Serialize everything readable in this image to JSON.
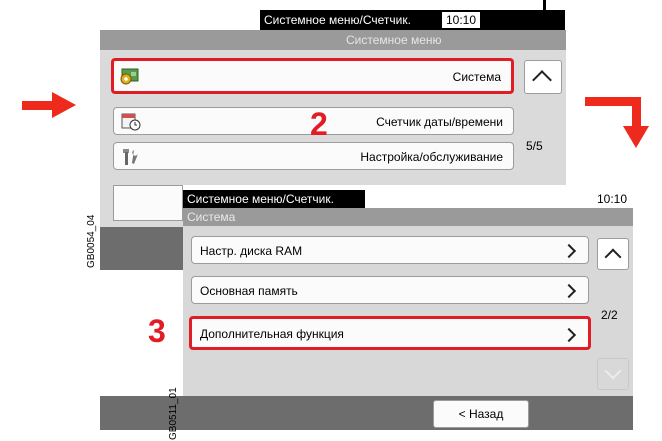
{
  "screen1": {
    "title": "Системное меню/Счетчик.",
    "time": "10:10",
    "subtitle": "Системное меню",
    "rows": [
      {
        "label": "Система",
        "icon": "system-gear-icon"
      },
      {
        "label": "Счетчик даты/времени",
        "icon": "calendar-clock-icon"
      },
      {
        "label": "Настройка/обслуживание",
        "icon": "tools-icon"
      }
    ],
    "page": "5/5",
    "step": "2",
    "figure_label": "GB0054_04"
  },
  "screen2": {
    "title": "Системное меню/Счетчик.",
    "time": "10:10",
    "subtitle": "Система",
    "rows": [
      {
        "label": "Настр. диска RAM"
      },
      {
        "label": "Основная память"
      },
      {
        "label": "Дополнительная функция"
      }
    ],
    "page": "2/2",
    "back_label": "< Назад",
    "step": "3",
    "figure_label": "GB0511_01"
  },
  "colors": {
    "highlight": "#e11c24",
    "arrow": "#ee2a1c"
  }
}
